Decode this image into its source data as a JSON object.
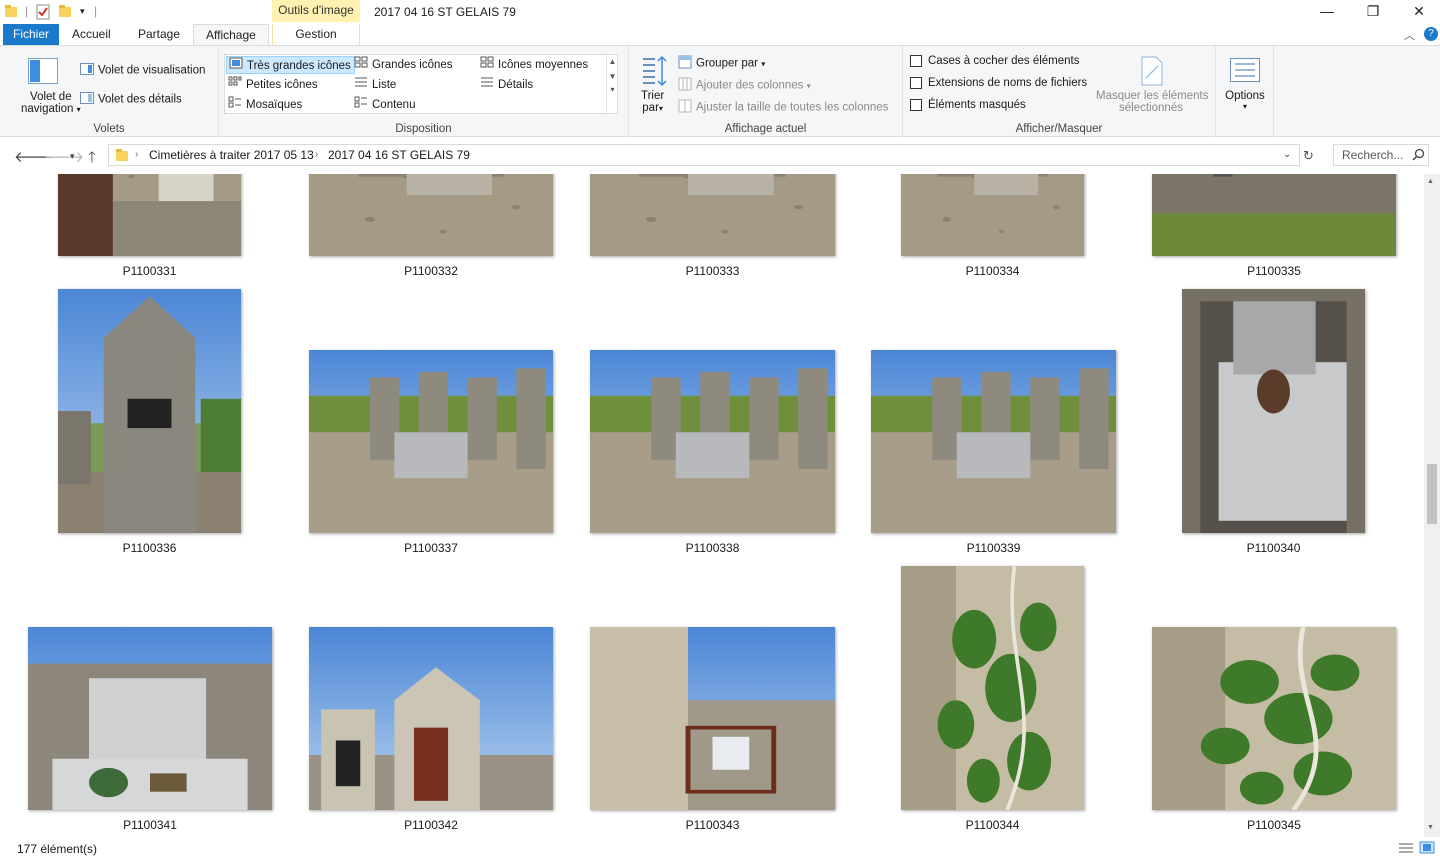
{
  "window": {
    "title": "2017 04 16 ST GELAIS 79",
    "context_tab": "Outils d'image",
    "minimize": "—",
    "maximize": "❐",
    "close": "✕"
  },
  "tabs": {
    "file": "Fichier",
    "home": "Accueil",
    "share": "Partage",
    "view": "Affichage",
    "manage": "Gestion"
  },
  "ribbon": {
    "panes": {
      "label": "Volets",
      "nav_pane_line1": "Volet de",
      "nav_pane_line2": "navigation",
      "preview_pane": "Volet de visualisation",
      "details_pane": "Volet des détails"
    },
    "layout": {
      "label": "Disposition",
      "items": [
        "Très grandes icônes",
        "Grandes icônes",
        "Icônes moyennes",
        "Petites icônes",
        "Liste",
        "Détails",
        "Mosaïques",
        "Contenu"
      ]
    },
    "current_view": {
      "label": "Affichage actuel",
      "sort_line1": "Trier",
      "sort_line2": "par",
      "group_by": "Grouper par",
      "add_columns": "Ajouter des colonnes",
      "size_columns": "Ajuster la taille de toutes les colonnes"
    },
    "show_hide": {
      "label": "Afficher/Masquer",
      "item_checkboxes": "Cases à cocher des éléments",
      "file_extensions": "Extensions de noms de fichiers",
      "hidden_items": "Éléments masqués",
      "hide_selected_line1": "Masquer les éléments",
      "hide_selected_line2": "sélectionnés"
    },
    "options": "Options"
  },
  "address": {
    "crumbs": [
      "Cimetières à traiter 2017 05 13",
      "2017 04 16 ST GELAIS 79"
    ],
    "search_placeholder": "Recherch..."
  },
  "files": [
    {
      "name": "P1100331",
      "scene": "grave"
    },
    {
      "name": "P1100332",
      "scene": "gravel"
    },
    {
      "name": "P1100333",
      "scene": "gravel"
    },
    {
      "name": "P1100334",
      "scene": "gravel"
    },
    {
      "name": "P1100335",
      "scene": "field"
    },
    {
      "name": "P1100336",
      "scene": "monument"
    },
    {
      "name": "P1100337",
      "scene": "crosses"
    },
    {
      "name": "P1100338",
      "scene": "crosses"
    },
    {
      "name": "P1100339",
      "scene": "crosses"
    },
    {
      "name": "P1100340",
      "scene": "slab"
    },
    {
      "name": "P1100341",
      "scene": "headstone"
    },
    {
      "name": "P1100342",
      "scene": "chapel"
    },
    {
      "name": "P1100343",
      "scene": "wall"
    },
    {
      "name": "P1100344",
      "scene": "ivy"
    },
    {
      "name": "P1100345",
      "scene": "ivy"
    }
  ],
  "status": {
    "count": "177 élément(s)"
  },
  "colors": {
    "accent": "#1979ca",
    "context": "#fff2b0",
    "selection": "#cce8ff"
  }
}
